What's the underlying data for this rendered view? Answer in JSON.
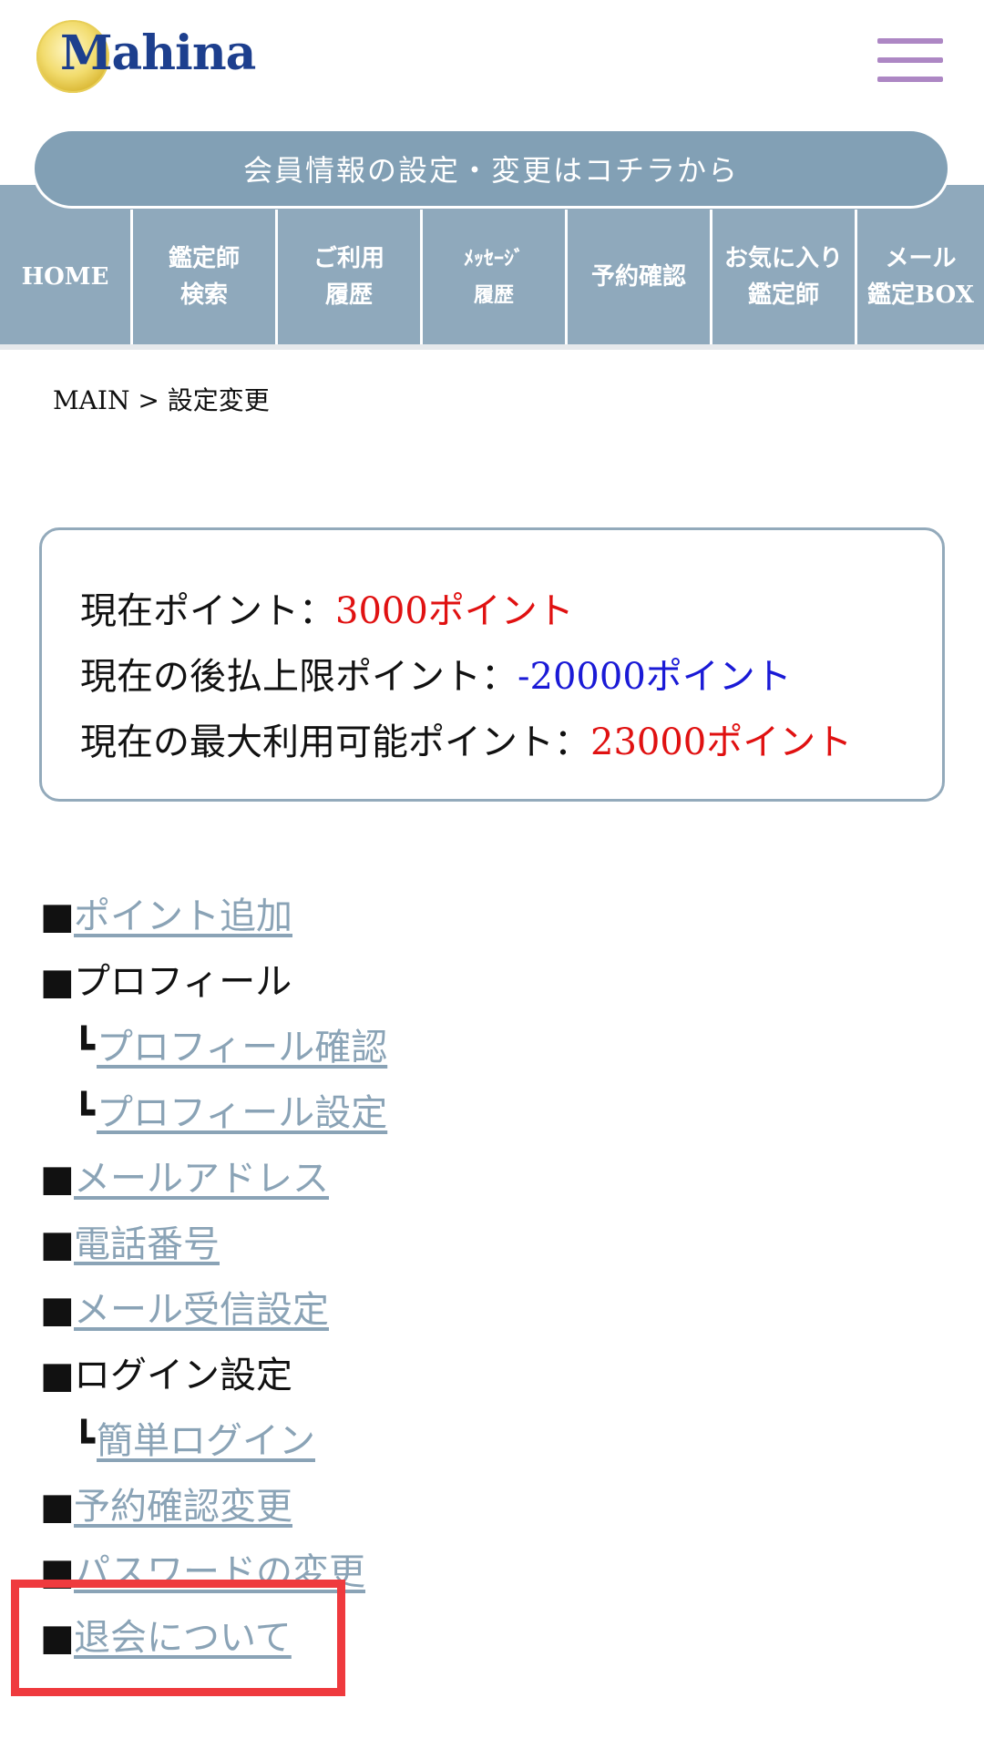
{
  "header": {
    "logo_text": "Mahina",
    "menu_icon": "hamburger-icon",
    "menu_color": "#ad87c4"
  },
  "member_bar": "会員情報の設定・変更はコチラから",
  "nav": [
    {
      "label": "HOME"
    },
    {
      "label": "鑑定師\n検索"
    },
    {
      "label": "ご利用\n履歴"
    },
    {
      "label": "ﾒｯｾｰｼﾞ\n履歴"
    },
    {
      "label": "予約確認"
    },
    {
      "label": "お気に入り\n鑑定師"
    },
    {
      "label": "メール\n鑑定BOX"
    }
  ],
  "breadcrumb": {
    "home": "MAIN",
    "separator": " > ",
    "current": "設定変更"
  },
  "points": {
    "current_label": "現在ポイント：",
    "current_value": "3000ポイント",
    "postpay_label": "現在の後払上限ポイント：",
    "postpay_value": "-20000ポイント",
    "max_label": "現在の最大利用可能ポイント：",
    "max_value": "23000ポイント"
  },
  "menu": {
    "bullet": "■",
    "sub_bullet": "┗",
    "add_points": "ポイント追加",
    "profile": "プロフィール",
    "profile_confirm": "プロフィール確認",
    "profile_settings": "プロフィール設定",
    "email": "メールアドレス",
    "phone": "電話番号",
    "mail_receive": "メール受信設定",
    "login_settings": "ログイン設定",
    "easy_login": "簡単ログイン",
    "reservation": "予約確認変更",
    "password": "パスワードの変更",
    "withdraw": "退会について"
  },
  "colors": {
    "nav_bg": "#8fa9bc",
    "link": "#8aa3b6",
    "highlight": "#ef3a3e",
    "point_red": "#e01111",
    "point_blue": "#1a1ad6"
  }
}
